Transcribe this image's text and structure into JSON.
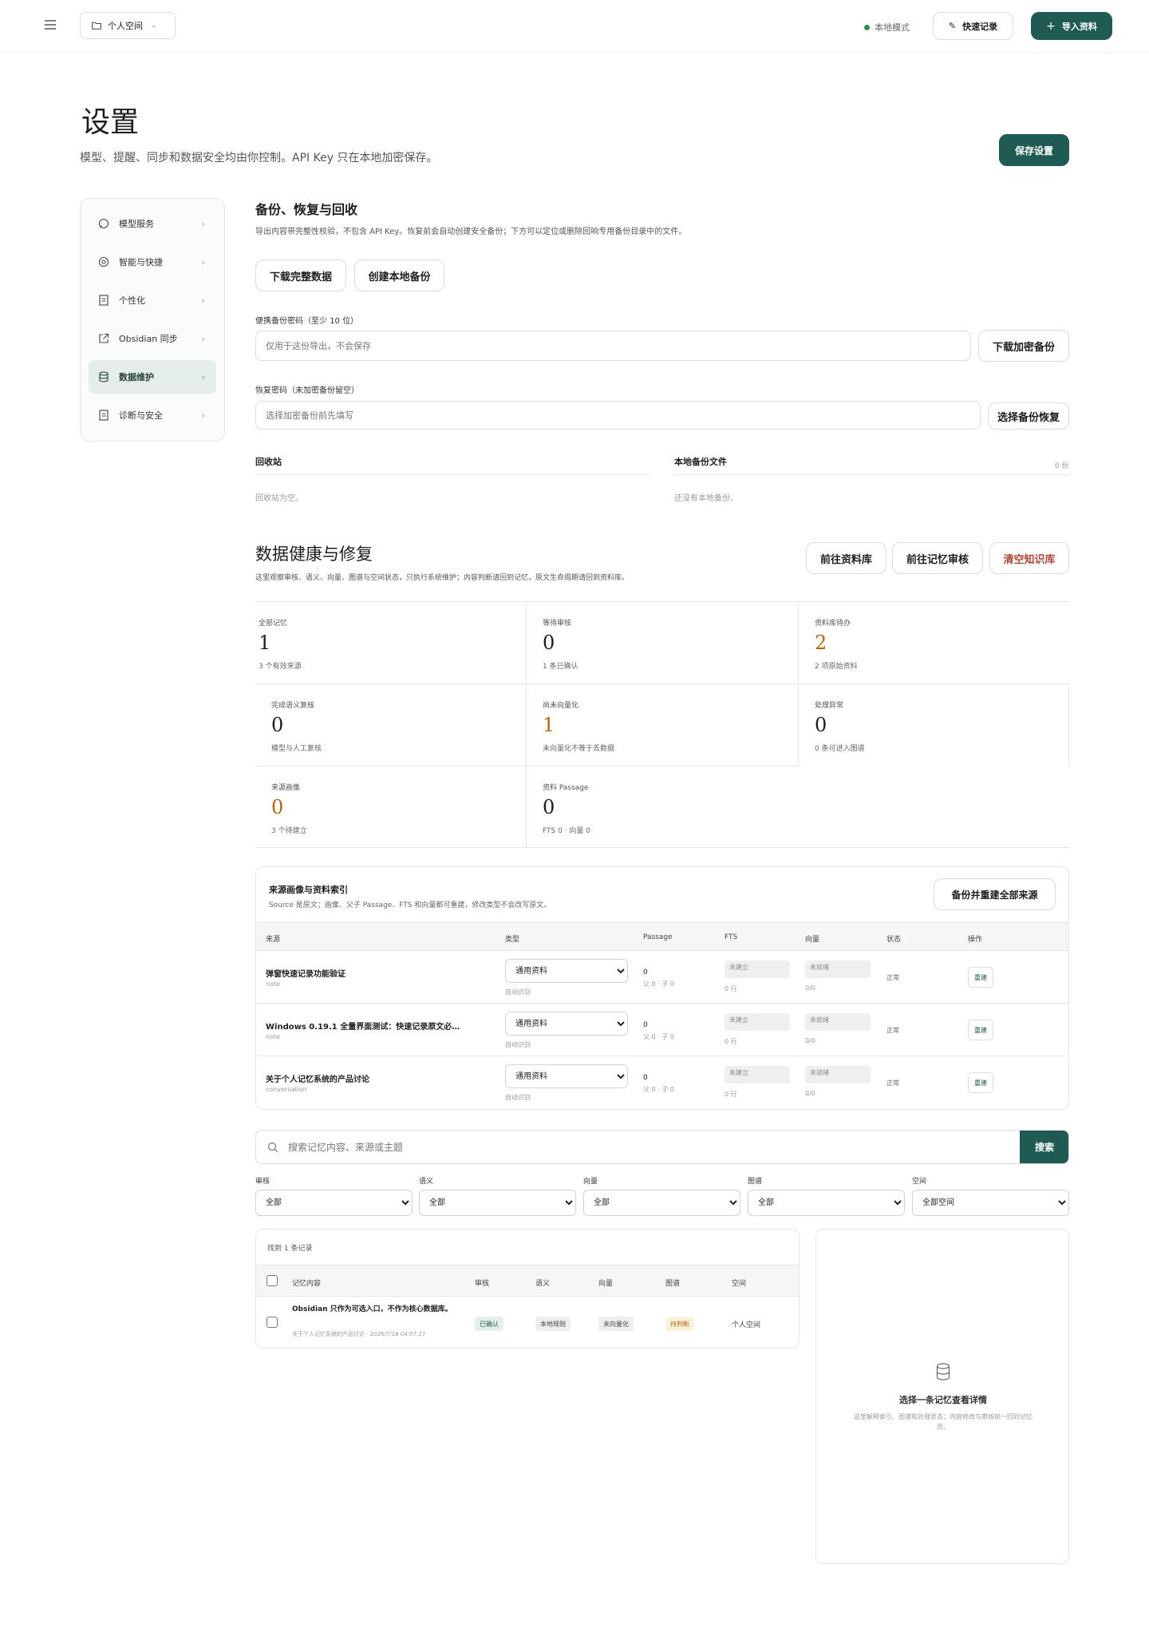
{
  "topbar": {
    "workspace_label": "个人空间",
    "mode_label": "本地模式",
    "quick_record_label": "快速记录",
    "import_label": "导入资料"
  },
  "page": {
    "title": "设置",
    "subtitle": "模型、提醒、同步和数据安全均由你控制。API Key 只在本地加密保存。",
    "save_label": "保存设置"
  },
  "sidebar": {
    "items": [
      {
        "label": "模型服务",
        "icon": "chat-bubble-icon"
      },
      {
        "label": "智能与快捷",
        "icon": "target-icon"
      },
      {
        "label": "个性化",
        "icon": "document-icon"
      },
      {
        "label": "Obsidian 同步",
        "icon": "external-link-icon"
      },
      {
        "label": "数据维护",
        "icon": "database-icon"
      },
      {
        "label": "诊断与安全",
        "icon": "document-icon"
      }
    ],
    "active_index": 4
  },
  "backup": {
    "title": "备份、恢复与回收",
    "desc": "导出内容带完整性校验，不包含 API Key。恢复前会自动创建安全备份；下方可以定位或删除回响专用备份目录中的文件。",
    "download_full_label": "下载完整数据",
    "create_local_label": "创建本地备份",
    "export_pwd_label": "便携备份密码（至少 10 位）",
    "export_pwd_placeholder": "仅用于这份导出，不会保存",
    "download_encrypted_label": "下载加密备份",
    "restore_pwd_label": "恢复密码（未加密备份留空）",
    "restore_pwd_placeholder": "选择加密备份前先填写",
    "choose_restore_label": "选择备份恢复",
    "recycle_title": "回收站",
    "recycle_empty": "回收站为空。",
    "local_files_title": "本地备份文件",
    "local_files_count": "0 份",
    "local_files_empty": "还没有本地备份。"
  },
  "health": {
    "title": "数据健康与修复",
    "desc": "这里观察审核、语义、向量、图谱与空间状态，只执行系统维护；内容判断请回到记忆，原文生命周期请回到资料库。",
    "goto_library_label": "前往资料库",
    "goto_review_label": "前往记忆审核",
    "clear_label": "清空知识库",
    "stats": [
      {
        "label": "全部记忆",
        "value": "1",
        "sub": "3 个有效来源",
        "tone": "dark"
      },
      {
        "label": "等待审核",
        "value": "0",
        "sub": "1 条已确认",
        "tone": "dark"
      },
      {
        "label": "资料库待办",
        "value": "2",
        "sub": "2 项原始资料",
        "tone": "orange"
      },
      {
        "label": "完成语义复核",
        "value": "0",
        "sub": "模型与人工复核",
        "tone": "dark"
      },
      {
        "label": "尚未向量化",
        "value": "1",
        "sub": "未向量化不等于丢数据",
        "tone": "orange"
      },
      {
        "label": "处理异常",
        "value": "0",
        "sub": "0 条可进入图谱",
        "tone": "dark"
      },
      {
        "label": "来源画像",
        "value": "0",
        "sub": "3 个待建立",
        "tone": "orange"
      },
      {
        "label": "资料 Passage",
        "value": "0",
        "sub": "FTS 0 · 向量 0",
        "tone": "dark"
      }
    ]
  },
  "sources": {
    "title": "来源画像与资料索引",
    "desc": "Source 是原文；画像、父子 Passage、FTS 和向量都可重建，修改类型不会改写原文。",
    "rebuild_label": "备份并重建全部来源",
    "columns": [
      "来源",
      "类型",
      "Passage",
      "FTS",
      "向量",
      "状态",
      "操作"
    ],
    "rows": [
      {
        "title": "弹窗快速记录功能验证",
        "kind": "note",
        "type": "通用资料",
        "type_hint": "自动识别",
        "passage": "0",
        "passage_sub": "父 0 · 子 0",
        "fts": "未建立",
        "fts_sub": "0 行",
        "vector": "未就绪",
        "vector_sub": "0/0",
        "status": "正常",
        "action": "重建"
      },
      {
        "title": "Windows 0.19.1 全量界面测试：快速记录原文必…",
        "kind": "note",
        "type": "通用资料",
        "type_hint": "自动识别",
        "passage": "0",
        "passage_sub": "父 0 · 子 0",
        "fts": "未建立",
        "fts_sub": "0 行",
        "vector": "未就绪",
        "vector_sub": "0/0",
        "status": "正常",
        "action": "重建"
      },
      {
        "title": "关于个人记忆系统的产品讨论",
        "kind": "conversation",
        "type": "通用资料",
        "type_hint": "自动识别",
        "passage": "0",
        "passage_sub": "父 0 · 子 0",
        "fts": "未建立",
        "fts_sub": "0 行",
        "vector": "未就绪",
        "vector_sub": "0/0",
        "status": "正常",
        "action": "重建"
      }
    ]
  },
  "search": {
    "placeholder": "搜索记忆内容、来源或主题",
    "button_label": "搜索",
    "filters": [
      {
        "label": "审核",
        "value": "全部"
      },
      {
        "label": "语义",
        "value": "全部"
      },
      {
        "label": "向量",
        "value": "全部"
      },
      {
        "label": "图谱",
        "value": "全部"
      },
      {
        "label": "空间",
        "value": "全部空间"
      }
    ]
  },
  "results": {
    "count_label": "找到 1 条记录",
    "columns": [
      "记忆内容",
      "审核",
      "语义",
      "向量",
      "图谱",
      "空间"
    ],
    "rows": [
      {
        "content": "Obsidian 只作为可选入口，不作为核心数据库。",
        "meta": "关于个人记忆系统的产品讨论 · 2026/7/18 04:07:27",
        "review": "已确认",
        "semantic": "本地规则",
        "vector": "未向量化",
        "graph": "待判断",
        "space": "个人空间"
      }
    ]
  },
  "detail": {
    "empty_title": "选择一条记忆查看详情",
    "empty_desc": "这里解释索引、图谱和处理状态；内容修改与审核统一回到记忆页。"
  },
  "colors": {
    "accent": "#1f5b52",
    "warning": "#b2670f",
    "danger": "#b0453a",
    "status_dot": "#2e8b57"
  }
}
